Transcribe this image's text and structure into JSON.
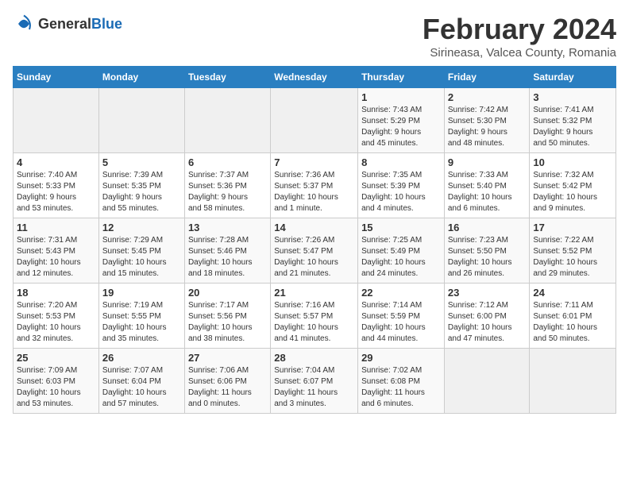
{
  "header": {
    "logo": {
      "general": "General",
      "blue": "Blue"
    },
    "month_year": "February 2024",
    "location": "Sirineasa, Valcea County, Romania"
  },
  "days_of_week": [
    "Sunday",
    "Monday",
    "Tuesday",
    "Wednesday",
    "Thursday",
    "Friday",
    "Saturday"
  ],
  "weeks": [
    [
      {
        "day": "",
        "info": ""
      },
      {
        "day": "",
        "info": ""
      },
      {
        "day": "",
        "info": ""
      },
      {
        "day": "",
        "info": ""
      },
      {
        "day": "1",
        "info": "Sunrise: 7:43 AM\nSunset: 5:29 PM\nDaylight: 9 hours\nand 45 minutes."
      },
      {
        "day": "2",
        "info": "Sunrise: 7:42 AM\nSunset: 5:30 PM\nDaylight: 9 hours\nand 48 minutes."
      },
      {
        "day": "3",
        "info": "Sunrise: 7:41 AM\nSunset: 5:32 PM\nDaylight: 9 hours\nand 50 minutes."
      }
    ],
    [
      {
        "day": "4",
        "info": "Sunrise: 7:40 AM\nSunset: 5:33 PM\nDaylight: 9 hours\nand 53 minutes."
      },
      {
        "day": "5",
        "info": "Sunrise: 7:39 AM\nSunset: 5:35 PM\nDaylight: 9 hours\nand 55 minutes."
      },
      {
        "day": "6",
        "info": "Sunrise: 7:37 AM\nSunset: 5:36 PM\nDaylight: 9 hours\nand 58 minutes."
      },
      {
        "day": "7",
        "info": "Sunrise: 7:36 AM\nSunset: 5:37 PM\nDaylight: 10 hours\nand 1 minute."
      },
      {
        "day": "8",
        "info": "Sunrise: 7:35 AM\nSunset: 5:39 PM\nDaylight: 10 hours\nand 4 minutes."
      },
      {
        "day": "9",
        "info": "Sunrise: 7:33 AM\nSunset: 5:40 PM\nDaylight: 10 hours\nand 6 minutes."
      },
      {
        "day": "10",
        "info": "Sunrise: 7:32 AM\nSunset: 5:42 PM\nDaylight: 10 hours\nand 9 minutes."
      }
    ],
    [
      {
        "day": "11",
        "info": "Sunrise: 7:31 AM\nSunset: 5:43 PM\nDaylight: 10 hours\nand 12 minutes."
      },
      {
        "day": "12",
        "info": "Sunrise: 7:29 AM\nSunset: 5:45 PM\nDaylight: 10 hours\nand 15 minutes."
      },
      {
        "day": "13",
        "info": "Sunrise: 7:28 AM\nSunset: 5:46 PM\nDaylight: 10 hours\nand 18 minutes."
      },
      {
        "day": "14",
        "info": "Sunrise: 7:26 AM\nSunset: 5:47 PM\nDaylight: 10 hours\nand 21 minutes."
      },
      {
        "day": "15",
        "info": "Sunrise: 7:25 AM\nSunset: 5:49 PM\nDaylight: 10 hours\nand 24 minutes."
      },
      {
        "day": "16",
        "info": "Sunrise: 7:23 AM\nSunset: 5:50 PM\nDaylight: 10 hours\nand 26 minutes."
      },
      {
        "day": "17",
        "info": "Sunrise: 7:22 AM\nSunset: 5:52 PM\nDaylight: 10 hours\nand 29 minutes."
      }
    ],
    [
      {
        "day": "18",
        "info": "Sunrise: 7:20 AM\nSunset: 5:53 PM\nDaylight: 10 hours\nand 32 minutes."
      },
      {
        "day": "19",
        "info": "Sunrise: 7:19 AM\nSunset: 5:55 PM\nDaylight: 10 hours\nand 35 minutes."
      },
      {
        "day": "20",
        "info": "Sunrise: 7:17 AM\nSunset: 5:56 PM\nDaylight: 10 hours\nand 38 minutes."
      },
      {
        "day": "21",
        "info": "Sunrise: 7:16 AM\nSunset: 5:57 PM\nDaylight: 10 hours\nand 41 minutes."
      },
      {
        "day": "22",
        "info": "Sunrise: 7:14 AM\nSunset: 5:59 PM\nDaylight: 10 hours\nand 44 minutes."
      },
      {
        "day": "23",
        "info": "Sunrise: 7:12 AM\nSunset: 6:00 PM\nDaylight: 10 hours\nand 47 minutes."
      },
      {
        "day": "24",
        "info": "Sunrise: 7:11 AM\nSunset: 6:01 PM\nDaylight: 10 hours\nand 50 minutes."
      }
    ],
    [
      {
        "day": "25",
        "info": "Sunrise: 7:09 AM\nSunset: 6:03 PM\nDaylight: 10 hours\nand 53 minutes."
      },
      {
        "day": "26",
        "info": "Sunrise: 7:07 AM\nSunset: 6:04 PM\nDaylight: 10 hours\nand 57 minutes."
      },
      {
        "day": "27",
        "info": "Sunrise: 7:06 AM\nSunset: 6:06 PM\nDaylight: 11 hours\nand 0 minutes."
      },
      {
        "day": "28",
        "info": "Sunrise: 7:04 AM\nSunset: 6:07 PM\nDaylight: 11 hours\nand 3 minutes."
      },
      {
        "day": "29",
        "info": "Sunrise: 7:02 AM\nSunset: 6:08 PM\nDaylight: 11 hours\nand 6 minutes."
      },
      {
        "day": "",
        "info": ""
      },
      {
        "day": "",
        "info": ""
      }
    ]
  ]
}
